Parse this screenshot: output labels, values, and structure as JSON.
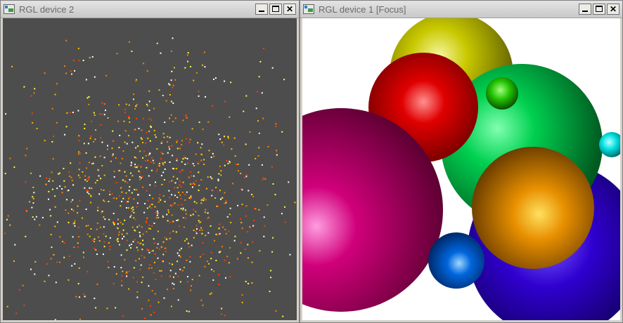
{
  "windows": [
    {
      "id": "device2",
      "title": "RGL device 2",
      "background": "#4d4d4d",
      "point_colors": [
        "#ff4000",
        "#ff8000",
        "#ffbf00",
        "#ffff40",
        "#ffffff"
      ]
    },
    {
      "id": "device1",
      "title": "RGL device 1 [Focus]",
      "background": "#ffffff",
      "sphere_colors": {
        "yellow": "#c8c800",
        "red": "#e00000",
        "green": "#00d050",
        "cyan": "#00e0e0",
        "magenta": "#d0007a",
        "blue_violet": "#3000d0",
        "orange": "#e89000",
        "blue": "#0066dd"
      }
    }
  ],
  "controls": {
    "minimize_icon": "minimize-icon",
    "maximize_icon": "maximize-icon",
    "close_glyph": "✕"
  }
}
